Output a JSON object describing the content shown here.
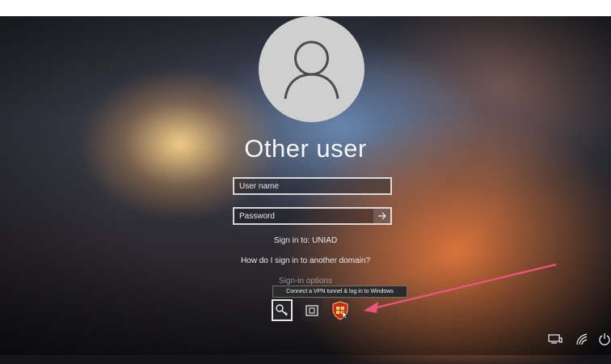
{
  "user": {
    "title": "Other user",
    "avatar_icon": "user-silhouette-icon"
  },
  "form": {
    "username_placeholder": "User name",
    "password_placeholder": "Password",
    "submit_icon": "arrow-right-icon"
  },
  "links": {
    "sign_in_to": "Sign in to: UNIAD",
    "domain_help": "How do I sign in to another domain?",
    "sign_in_options": "Sign-in options"
  },
  "credential_providers": {
    "tooltip": "Connect a VPN tunnel & log in to Windows",
    "items": [
      {
        "name": "key",
        "icon": "key-icon",
        "selected": true
      },
      {
        "name": "smart-card",
        "icon": "smart-card-icon",
        "selected": false
      },
      {
        "name": "vpn",
        "icon": "vpn-shield-icon",
        "selected": false
      }
    ]
  },
  "annotation": {
    "color": "#e8557a"
  },
  "system_tray": {
    "icons": [
      "network-icon",
      "ease-of-access-icon",
      "power-icon"
    ]
  }
}
